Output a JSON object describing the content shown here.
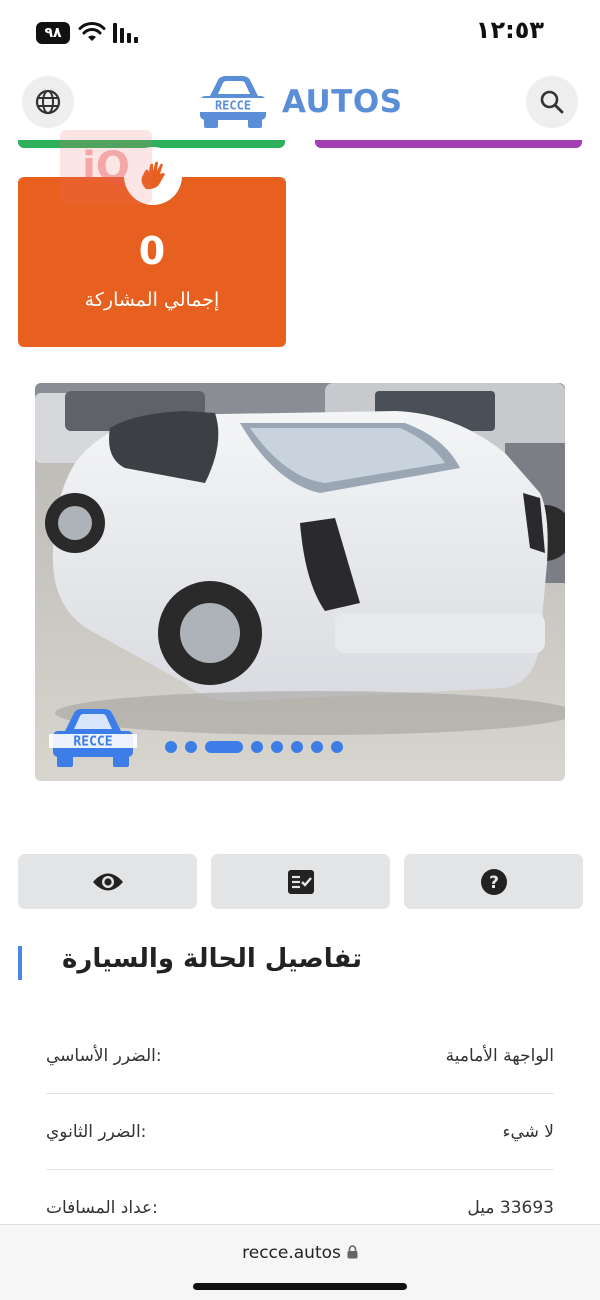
{
  "status_bar": {
    "battery": "٩٨",
    "time": "١٢:٥٣"
  },
  "header": {
    "logo_badge_text": "RECCE",
    "logo_text": "AUTOS",
    "left_icon": "globe-icon",
    "right_icon": "search-icon"
  },
  "stats_card": {
    "value": "0",
    "label": "إجمالي المشاركة",
    "badge_icon": "waving-hand-icon",
    "color": "#e8601f"
  },
  "watermark": {
    "text": "iQ"
  },
  "gallery": {
    "image_description_icon": "car-photo",
    "overlay_logo_text": "RECCE",
    "dots_count": 8,
    "active_dot": 3
  },
  "actions": [
    {
      "icon": "eye-icon"
    },
    {
      "icon": "checklist-icon"
    },
    {
      "icon": "help-icon"
    }
  ],
  "section": {
    "title": "تفاصيل الحالة والسيارة"
  },
  "details": [
    {
      "label": ":الضرر الأساسي",
      "value": "الواجهة الأمامية"
    },
    {
      "label": ":الضرر الثانوي",
      "value": "لا شيء"
    },
    {
      "label": ":عداد المسافات",
      "value": "33693 ميل"
    }
  ],
  "browser": {
    "url": "recce.autos"
  },
  "colors": {
    "accent": "#4a86e8",
    "logo_blue": "#5a8fd8",
    "green_strip": "#2eaf5c",
    "purple_strip": "#a43db5",
    "button_bg": "#e3e4e6"
  }
}
